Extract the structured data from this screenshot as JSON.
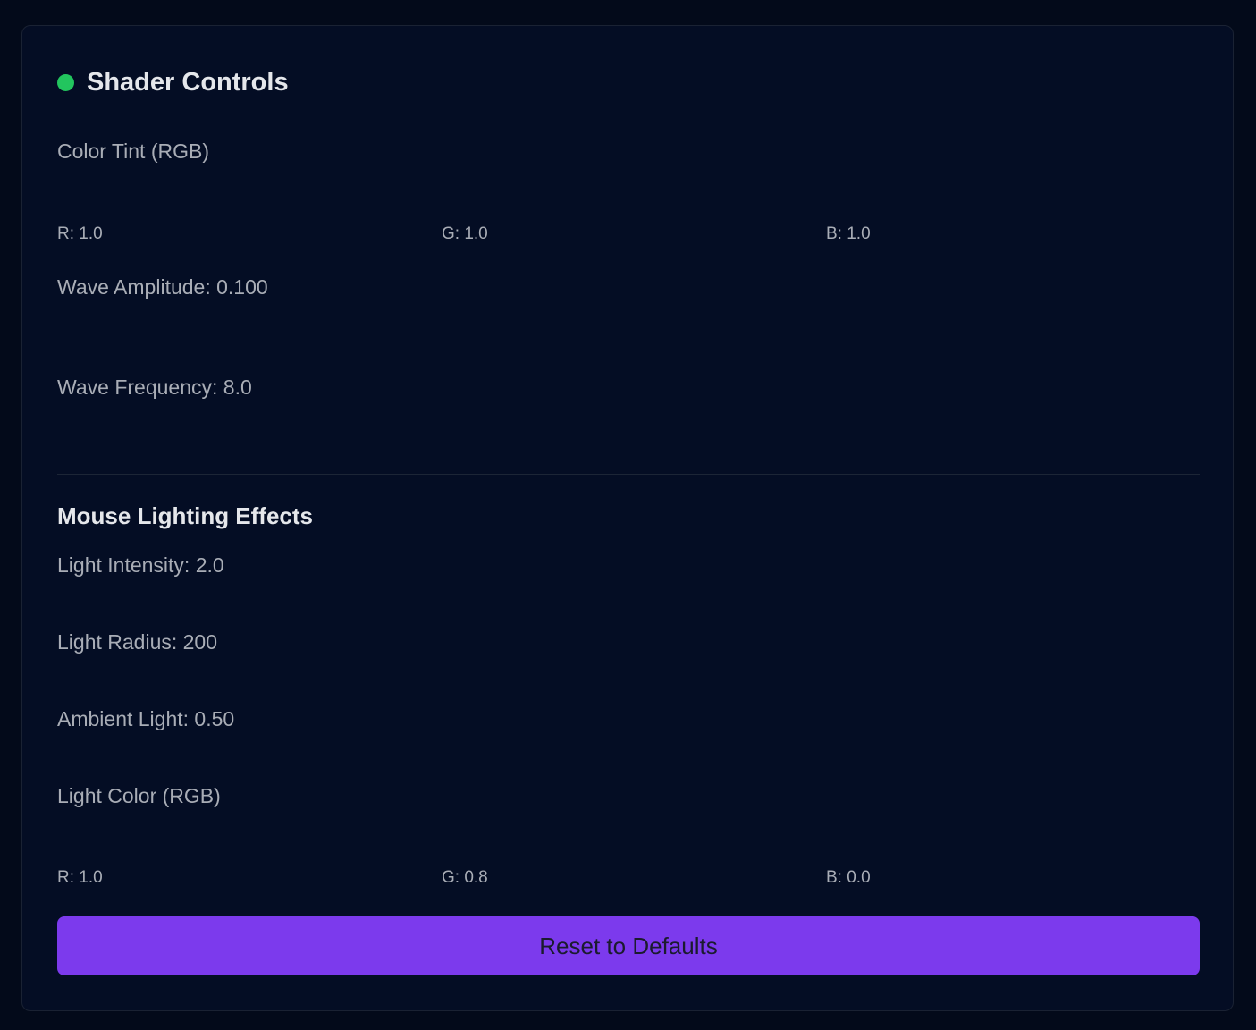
{
  "header": {
    "title": "Shader Controls",
    "status_color": "#22c55e"
  },
  "color_tint": {
    "label": "Color Tint (RGB)",
    "r_label": "R: 1.0",
    "g_label": "G: 1.0",
    "b_label": "B: 1.0"
  },
  "wave_amplitude": {
    "label": "Wave Amplitude: 0.100"
  },
  "wave_frequency": {
    "label": "Wave Frequency: 8.0"
  },
  "lighting": {
    "title": "Mouse Lighting Effects",
    "intensity_label": "Light Intensity: 2.0",
    "radius_label": "Light Radius: 200",
    "ambient_label": "Ambient Light: 0.50",
    "color_label": "Light Color (RGB)",
    "r_label": "R: 1.0",
    "g_label": "G: 0.8",
    "b_label": "B: 0.0"
  },
  "reset": {
    "label": "Reset to Defaults",
    "color": "#7c3aed"
  }
}
